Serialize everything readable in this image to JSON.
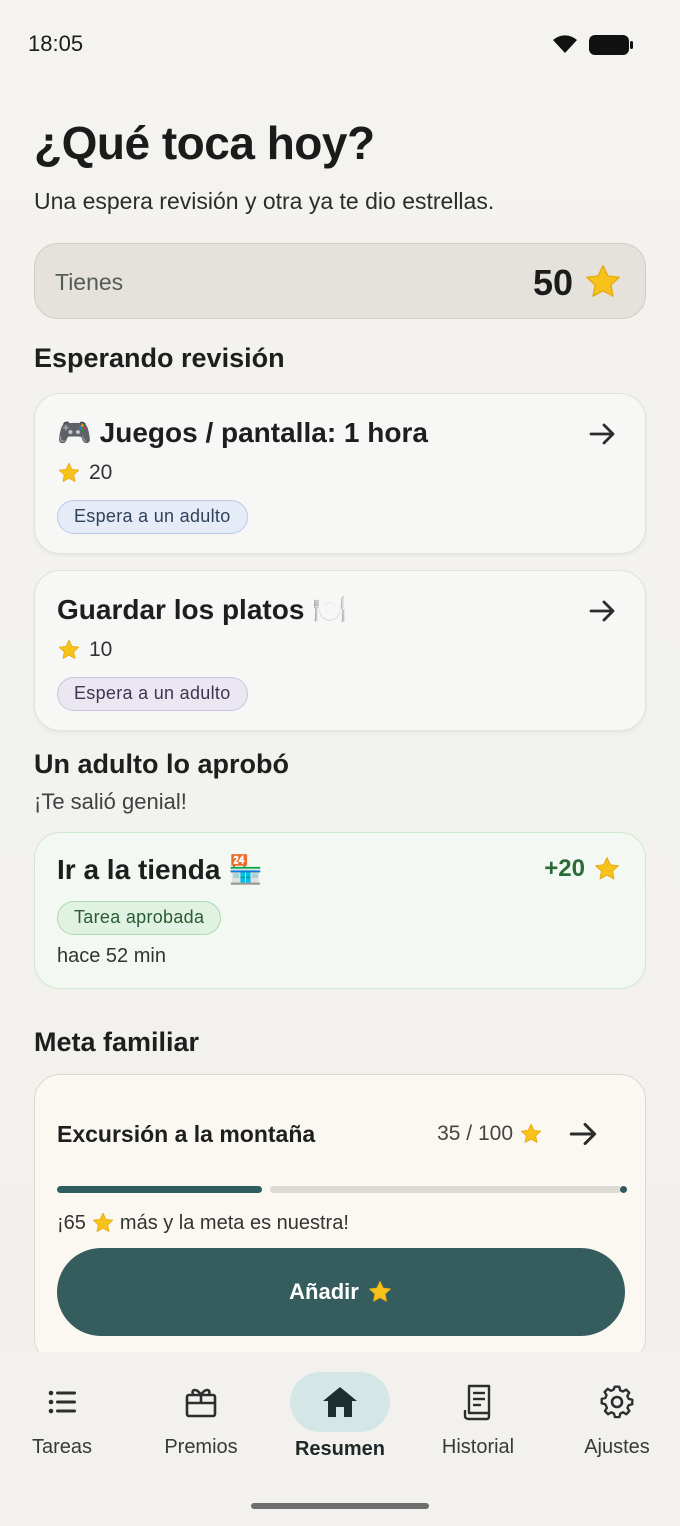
{
  "status": {
    "time": "18:05"
  },
  "header": {
    "title": "¿Qué toca hoy?",
    "subtitle": "Una espera revisión y otra ya te dio estrellas."
  },
  "balance": {
    "label": "Tienes",
    "value": "50"
  },
  "pending": {
    "title": "Esperando revisión",
    "items": [
      {
        "title": "🎮 Juegos / pantalla: 1 hora",
        "points": "20",
        "status": "Espera a un adulto"
      },
      {
        "title": "Guardar los platos 🍽️",
        "points": "10",
        "status": "Espera a un adulto"
      }
    ]
  },
  "approved": {
    "title": "Un adulto lo aprobó",
    "subtitle": "¡Te salió genial!",
    "item": {
      "title": "Ir a la tienda 🏪",
      "points": "+20",
      "status": "Tarea aprobada",
      "time": "hace 52 min"
    }
  },
  "goal": {
    "section_title": "Meta familiar",
    "title": "Excursión a la montaña",
    "progress_text": "35 / 100",
    "progress_fraction": 0.35,
    "remaining_prefix": "¡65",
    "remaining_suffix": "más y la meta es nuestra!",
    "button_label": "Añadir"
  },
  "nav": {
    "items": [
      {
        "label": "Tareas",
        "icon": "list-icon"
      },
      {
        "label": "Premios",
        "icon": "gift-icon"
      },
      {
        "label": "Resumen",
        "icon": "home-icon",
        "active": true
      },
      {
        "label": "Historial",
        "icon": "receipt-icon"
      },
      {
        "label": "Ajustes",
        "icon": "gear-icon"
      }
    ]
  },
  "colors": {
    "accent": "#355d5d",
    "star": "#f5c518",
    "approved_green": "#2a6b38"
  }
}
